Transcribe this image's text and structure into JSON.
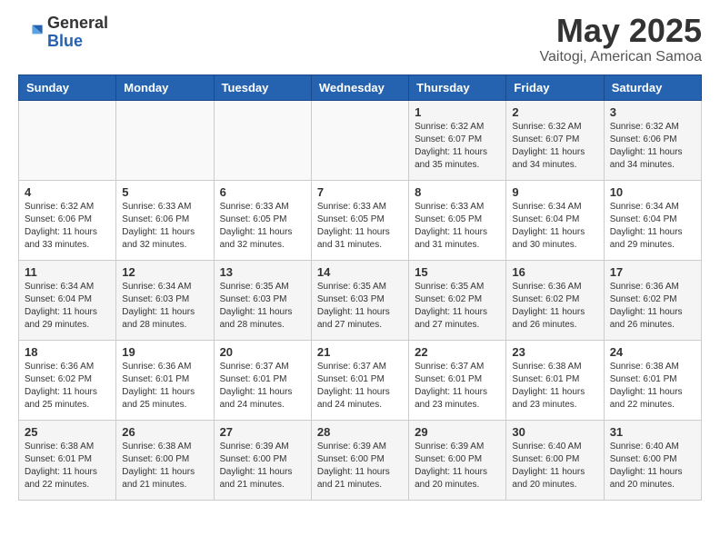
{
  "header": {
    "logo_general": "General",
    "logo_blue": "Blue",
    "month": "May 2025",
    "location": "Vaitogi, American Samoa"
  },
  "weekdays": [
    "Sunday",
    "Monday",
    "Tuesday",
    "Wednesday",
    "Thursday",
    "Friday",
    "Saturday"
  ],
  "weeks": [
    [
      {
        "day": "",
        "info": ""
      },
      {
        "day": "",
        "info": ""
      },
      {
        "day": "",
        "info": ""
      },
      {
        "day": "",
        "info": ""
      },
      {
        "day": "1",
        "info": "Sunrise: 6:32 AM\nSunset: 6:07 PM\nDaylight: 11 hours\nand 35 minutes."
      },
      {
        "day": "2",
        "info": "Sunrise: 6:32 AM\nSunset: 6:07 PM\nDaylight: 11 hours\nand 34 minutes."
      },
      {
        "day": "3",
        "info": "Sunrise: 6:32 AM\nSunset: 6:06 PM\nDaylight: 11 hours\nand 34 minutes."
      }
    ],
    [
      {
        "day": "4",
        "info": "Sunrise: 6:32 AM\nSunset: 6:06 PM\nDaylight: 11 hours\nand 33 minutes."
      },
      {
        "day": "5",
        "info": "Sunrise: 6:33 AM\nSunset: 6:06 PM\nDaylight: 11 hours\nand 32 minutes."
      },
      {
        "day": "6",
        "info": "Sunrise: 6:33 AM\nSunset: 6:05 PM\nDaylight: 11 hours\nand 32 minutes."
      },
      {
        "day": "7",
        "info": "Sunrise: 6:33 AM\nSunset: 6:05 PM\nDaylight: 11 hours\nand 31 minutes."
      },
      {
        "day": "8",
        "info": "Sunrise: 6:33 AM\nSunset: 6:05 PM\nDaylight: 11 hours\nand 31 minutes."
      },
      {
        "day": "9",
        "info": "Sunrise: 6:34 AM\nSunset: 6:04 PM\nDaylight: 11 hours\nand 30 minutes."
      },
      {
        "day": "10",
        "info": "Sunrise: 6:34 AM\nSunset: 6:04 PM\nDaylight: 11 hours\nand 29 minutes."
      }
    ],
    [
      {
        "day": "11",
        "info": "Sunrise: 6:34 AM\nSunset: 6:04 PM\nDaylight: 11 hours\nand 29 minutes."
      },
      {
        "day": "12",
        "info": "Sunrise: 6:34 AM\nSunset: 6:03 PM\nDaylight: 11 hours\nand 28 minutes."
      },
      {
        "day": "13",
        "info": "Sunrise: 6:35 AM\nSunset: 6:03 PM\nDaylight: 11 hours\nand 28 minutes."
      },
      {
        "day": "14",
        "info": "Sunrise: 6:35 AM\nSunset: 6:03 PM\nDaylight: 11 hours\nand 27 minutes."
      },
      {
        "day": "15",
        "info": "Sunrise: 6:35 AM\nSunset: 6:02 PM\nDaylight: 11 hours\nand 27 minutes."
      },
      {
        "day": "16",
        "info": "Sunrise: 6:36 AM\nSunset: 6:02 PM\nDaylight: 11 hours\nand 26 minutes."
      },
      {
        "day": "17",
        "info": "Sunrise: 6:36 AM\nSunset: 6:02 PM\nDaylight: 11 hours\nand 26 minutes."
      }
    ],
    [
      {
        "day": "18",
        "info": "Sunrise: 6:36 AM\nSunset: 6:02 PM\nDaylight: 11 hours\nand 25 minutes."
      },
      {
        "day": "19",
        "info": "Sunrise: 6:36 AM\nSunset: 6:01 PM\nDaylight: 11 hours\nand 25 minutes."
      },
      {
        "day": "20",
        "info": "Sunrise: 6:37 AM\nSunset: 6:01 PM\nDaylight: 11 hours\nand 24 minutes."
      },
      {
        "day": "21",
        "info": "Sunrise: 6:37 AM\nSunset: 6:01 PM\nDaylight: 11 hours\nand 24 minutes."
      },
      {
        "day": "22",
        "info": "Sunrise: 6:37 AM\nSunset: 6:01 PM\nDaylight: 11 hours\nand 23 minutes."
      },
      {
        "day": "23",
        "info": "Sunrise: 6:38 AM\nSunset: 6:01 PM\nDaylight: 11 hours\nand 23 minutes."
      },
      {
        "day": "24",
        "info": "Sunrise: 6:38 AM\nSunset: 6:01 PM\nDaylight: 11 hours\nand 22 minutes."
      }
    ],
    [
      {
        "day": "25",
        "info": "Sunrise: 6:38 AM\nSunset: 6:01 PM\nDaylight: 11 hours\nand 22 minutes."
      },
      {
        "day": "26",
        "info": "Sunrise: 6:38 AM\nSunset: 6:00 PM\nDaylight: 11 hours\nand 21 minutes."
      },
      {
        "day": "27",
        "info": "Sunrise: 6:39 AM\nSunset: 6:00 PM\nDaylight: 11 hours\nand 21 minutes."
      },
      {
        "day": "28",
        "info": "Sunrise: 6:39 AM\nSunset: 6:00 PM\nDaylight: 11 hours\nand 21 minutes."
      },
      {
        "day": "29",
        "info": "Sunrise: 6:39 AM\nSunset: 6:00 PM\nDaylight: 11 hours\nand 20 minutes."
      },
      {
        "day": "30",
        "info": "Sunrise: 6:40 AM\nSunset: 6:00 PM\nDaylight: 11 hours\nand 20 minutes."
      },
      {
        "day": "31",
        "info": "Sunrise: 6:40 AM\nSunset: 6:00 PM\nDaylight: 11 hours\nand 20 minutes."
      }
    ]
  ]
}
